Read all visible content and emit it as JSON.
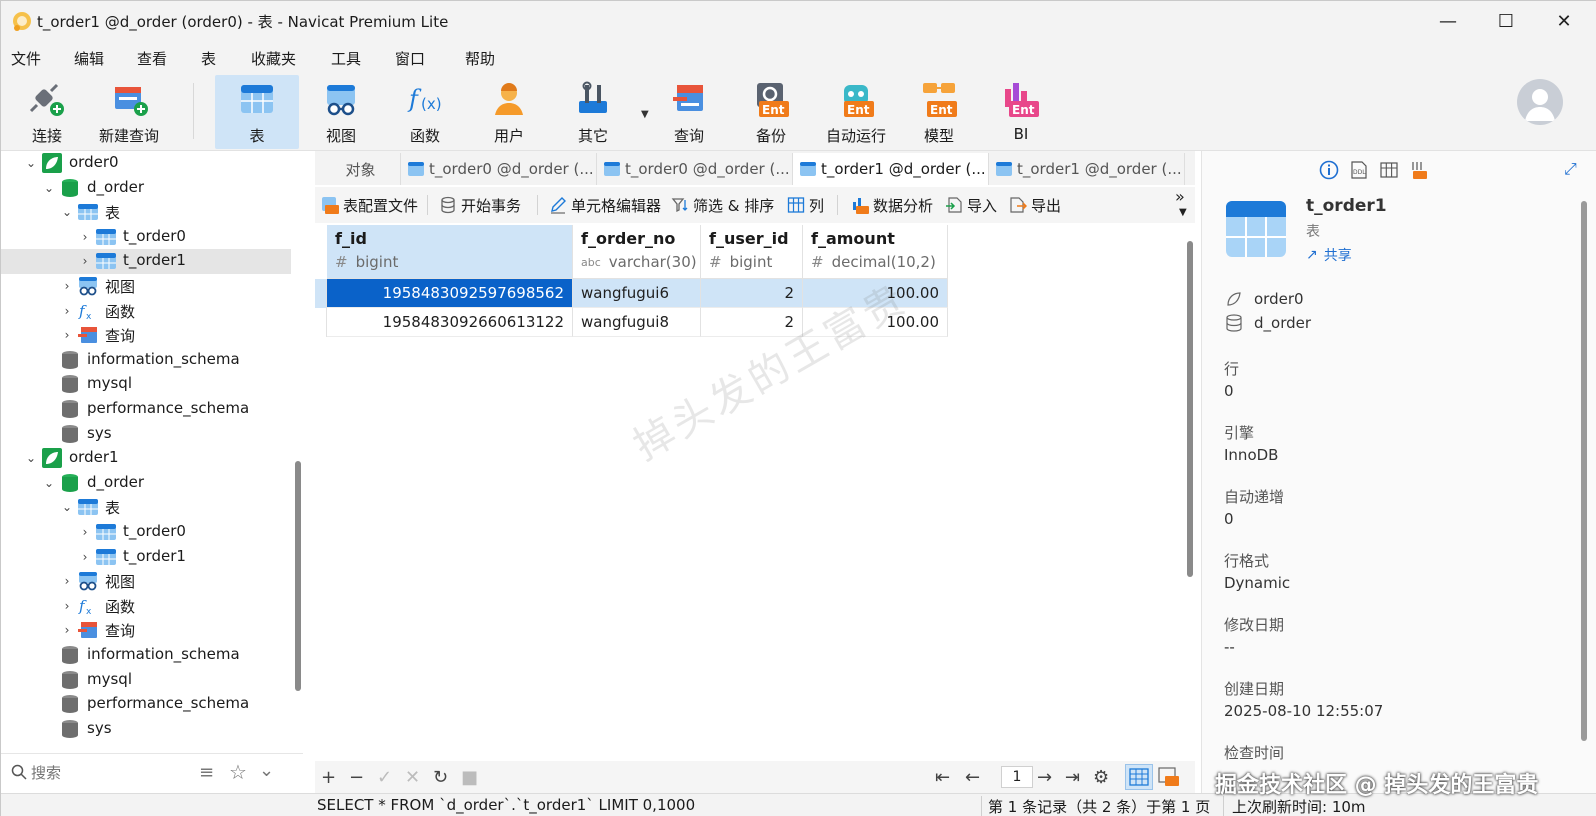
{
  "window": {
    "title": "t_order1 @d_order (order0) - 表 - Navicat Premium Lite",
    "minimize": "—",
    "maximize": "☐",
    "close": "✕"
  },
  "menu": [
    "文件",
    "编辑",
    "查看",
    "表",
    "收藏夹",
    "工具",
    "窗口",
    "帮助"
  ],
  "toolbar": {
    "items": [
      {
        "label": "连接",
        "icon": "connection-plug-icon"
      },
      {
        "label": "新建查询",
        "icon": "new-query-icon"
      },
      {
        "label": "表",
        "icon": "table-icon"
      },
      {
        "label": "视图",
        "icon": "view-glasses-icon"
      },
      {
        "label": "函数",
        "icon": "function-fx-icon"
      },
      {
        "label": "用户",
        "icon": "user-icon"
      },
      {
        "label": "其它",
        "icon": "tools-icon"
      },
      {
        "label": "查询",
        "icon": "query-icon"
      },
      {
        "label": "备份",
        "icon": "backup-ent-icon"
      },
      {
        "label": "自动运行",
        "icon": "automation-ent-icon"
      },
      {
        "label": "模型",
        "icon": "model-ent-icon"
      },
      {
        "label": "BI",
        "icon": "bi-ent-icon"
      }
    ]
  },
  "tree": {
    "items": [
      {
        "label": "order0",
        "depth": 0,
        "kind": "connection",
        "chevron": "open"
      },
      {
        "label": "d_order",
        "depth": 1,
        "kind": "database-green",
        "chevron": "open"
      },
      {
        "label": "表",
        "depth": 2,
        "kind": "table-folder",
        "chevron": "open"
      },
      {
        "label": "t_order0",
        "depth": 3,
        "kind": "table",
        "chevron": "closed"
      },
      {
        "label": "t_order1",
        "depth": 3,
        "kind": "table",
        "chevron": "closed",
        "selected": true
      },
      {
        "label": "视图",
        "depth": 2,
        "kind": "view",
        "chevron": "closed"
      },
      {
        "label": "函数",
        "depth": 2,
        "kind": "function",
        "chevron": "closed"
      },
      {
        "label": "查询",
        "depth": 2,
        "kind": "query",
        "chevron": "closed"
      },
      {
        "label": "information_schema",
        "depth": 1,
        "kind": "database-gray",
        "chevron": "none"
      },
      {
        "label": "mysql",
        "depth": 1,
        "kind": "database-gray",
        "chevron": "none"
      },
      {
        "label": "performance_schema",
        "depth": 1,
        "kind": "database-gray",
        "chevron": "none"
      },
      {
        "label": "sys",
        "depth": 1,
        "kind": "database-gray",
        "chevron": "none"
      },
      {
        "label": "order1",
        "depth": 0,
        "kind": "connection",
        "chevron": "open"
      },
      {
        "label": "d_order",
        "depth": 1,
        "kind": "database-green",
        "chevron": "open"
      },
      {
        "label": "表",
        "depth": 2,
        "kind": "table-folder",
        "chevron": "open"
      },
      {
        "label": "t_order0",
        "depth": 3,
        "kind": "table",
        "chevron": "closed"
      },
      {
        "label": "t_order1",
        "depth": 3,
        "kind": "table",
        "chevron": "closed"
      },
      {
        "label": "视图",
        "depth": 2,
        "kind": "view",
        "chevron": "closed"
      },
      {
        "label": "函数",
        "depth": 2,
        "kind": "function",
        "chevron": "closed"
      },
      {
        "label": "查询",
        "depth": 2,
        "kind": "query",
        "chevron": "closed"
      },
      {
        "label": "information_schema",
        "depth": 1,
        "kind": "database-gray",
        "chevron": "none"
      },
      {
        "label": "mysql",
        "depth": 1,
        "kind": "database-gray",
        "chevron": "none"
      },
      {
        "label": "performance_schema",
        "depth": 1,
        "kind": "database-gray",
        "chevron": "none"
      },
      {
        "label": "sys",
        "depth": 1,
        "kind": "database-gray",
        "chevron": "none"
      }
    ]
  },
  "search": {
    "placeholder": "搜索"
  },
  "tabs": [
    {
      "label": "对象",
      "active": false
    },
    {
      "label": "t_order0 @d_order (...",
      "active": false
    },
    {
      "label": "t_order0 @d_order (...",
      "active": false
    },
    {
      "label": "t_order1 @d_order (...",
      "active": true
    },
    {
      "label": "t_order1 @d_order (...",
      "active": false
    }
  ],
  "objbar": {
    "profile": "表配置文件",
    "begin_tx": "开始事务",
    "cell_editor": "单元格编辑器",
    "filter_sort": "筛选 & 排序",
    "columns": "列",
    "analysis": "数据分析",
    "import": "导入",
    "export": "导出"
  },
  "grid": {
    "columns": [
      {
        "name": "f_id",
        "type": "bigint",
        "type_icon": "#"
      },
      {
        "name": "f_order_no",
        "type": "varchar(30)",
        "type_icon": "abc"
      },
      {
        "name": "f_user_id",
        "type": "bigint",
        "type_icon": "#"
      },
      {
        "name": "f_amount",
        "type": "decimal(10,2)",
        "type_icon": "#"
      }
    ],
    "rows": [
      [
        "1958483092597698562",
        "wangfugui6",
        "2",
        "100.00"
      ],
      [
        "1958483092660613122",
        "wangfugui8",
        "2",
        "100.00"
      ]
    ],
    "watermark": "掉头发的王富贵"
  },
  "gridbar": {
    "add": "+",
    "remove": "−",
    "apply": "✓",
    "discard": "✕",
    "refresh": "↻",
    "stop": "■",
    "first": "⇤",
    "prev": "←",
    "page": "1",
    "next": "→",
    "last": "⇥",
    "settings": "⚙"
  },
  "status": {
    "sql": "SELECT * FROM `d_order`.`t_order1` LIMIT 0,1000",
    "records": "第 1 条记录（共 2 条）于第 1 页",
    "refresh": "上次刷新时间: 10m"
  },
  "info": {
    "title": "t_order1",
    "subtitle": "表",
    "share": "共享",
    "connection": "order0",
    "database": "d_order",
    "fields": [
      {
        "label": "行",
        "value": "0"
      },
      {
        "label": "引擎",
        "value": "InnoDB"
      },
      {
        "label": "自动递增",
        "value": "0"
      },
      {
        "label": "行格式",
        "value": "Dynamic"
      },
      {
        "label": "修改日期",
        "value": "--"
      },
      {
        "label": "创建日期",
        "value": "2025-08-10 12:55:07"
      },
      {
        "label": "检查时间",
        "value": ""
      }
    ]
  },
  "corner_watermark": "掘金技术社区 @ 掉头发的王富贵",
  "colors": {
    "accent": "#1f6fd1",
    "selection": "#cfe4f7",
    "focus_cell": "#0a62c9",
    "db_green": "#1aa04a"
  }
}
